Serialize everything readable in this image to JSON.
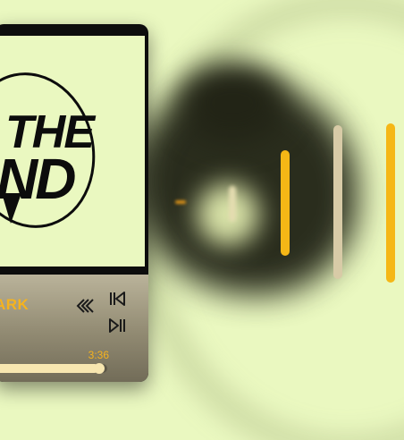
{
  "cover": {
    "line1": "THE",
    "line2": "ND"
  },
  "player": {
    "track_title": "ARK",
    "duration": "3:36",
    "progress_fraction": 0.93,
    "controls": {
      "rewind_icon": "rewind-icon",
      "previous_icon": "skip-previous-icon",
      "playpause_icon": "play-pause-icon"
    }
  },
  "colors": {
    "background": "#eaf8c0",
    "accent": "#f6b31d",
    "card": "#0d0d0d",
    "panel": "#918a72",
    "progress": "#f7e6b0"
  }
}
